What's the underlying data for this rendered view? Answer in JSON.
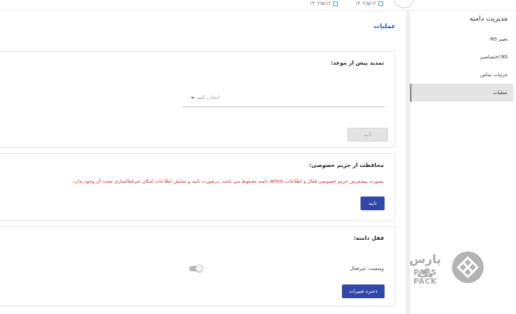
{
  "header": {
    "dates": [
      "۱۴۰۲/۵/۱۲",
      "۱۴۰۲/۵/۱۲"
    ]
  },
  "sidebar": {
    "title": "مدیریت دامنه",
    "items": [
      {
        "label": "تغییر NS"
      },
      {
        "label": "NS اختصاصی"
      },
      {
        "label": "جزئیات تماس"
      },
      {
        "label": "عملیات"
      }
    ],
    "active": "عملیات"
  },
  "main": {
    "heading": "عملیات",
    "renewal": {
      "title": "تمدید پیش از موعد:",
      "select_placeholder": "انتخاب کنید",
      "confirm_label": "تایید"
    },
    "privacy": {
      "title": "محافظت از حریم خصوصی:",
      "warning": "بصورت پیشفرض حریم خصوصی فعال و اطلاعات whois دامنه محفوظ می باشد، درصورت تایید و نمایش اطلاعات امکان غیرفعالسازی مجدد آن وجود ندارد.",
      "confirm_label": "تایید"
    },
    "lock": {
      "title": "قفل دامنه:",
      "status_label": "وضعیت: غیرفعال",
      "save_label": "ذخیره تغییرات"
    }
  },
  "branding": {
    "logo_fa": "پارس پک",
    "logo_en": "PARS PACK"
  },
  "colors": {
    "accent": "#3347a8",
    "heading": "#2b5aa8",
    "warning": "#d32f2f"
  }
}
